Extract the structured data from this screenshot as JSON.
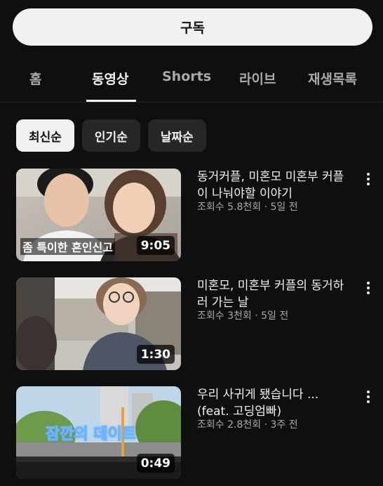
{
  "header": {
    "subscribe_label": "구독"
  },
  "tabs": [
    {
      "label": "홈"
    },
    {
      "label": "동영상"
    },
    {
      "label": "Shorts"
    },
    {
      "label": "라이브"
    },
    {
      "label": "재생목록"
    }
  ],
  "active_tab": "동영상",
  "sort_chips": [
    {
      "label": "최신순",
      "selected": true
    },
    {
      "label": "인기순",
      "selected": false
    },
    {
      "label": "날짜순",
      "selected": false
    }
  ],
  "videos": [
    {
      "title": "동거커플, 미혼모 미혼부 커플이 나눠야할 이야기",
      "meta": "조회수 5.8천회 · 5일 전",
      "duration": "9:05",
      "thumb_caption": "좀 특이한 혼인신고"
    },
    {
      "title": "미혼모, 미혼부 커플의 동거하러 가는 날",
      "meta": "조회수 3천회 · 5일 전",
      "duration": "1:30",
      "thumb_caption": ""
    },
    {
      "title": "우리 사귀게 됐습니다 ... (feat. 고딩엄빠)",
      "meta": "조회수 2.8천회 · 3주 전",
      "duration": "0:49",
      "thumb_caption": "잠깐의 데이트"
    }
  ],
  "colors": {
    "background": "#0f0f0f",
    "text": "#f1f1f1",
    "secondary_text": "#aaaaaa",
    "chip_bg": "#272727"
  }
}
